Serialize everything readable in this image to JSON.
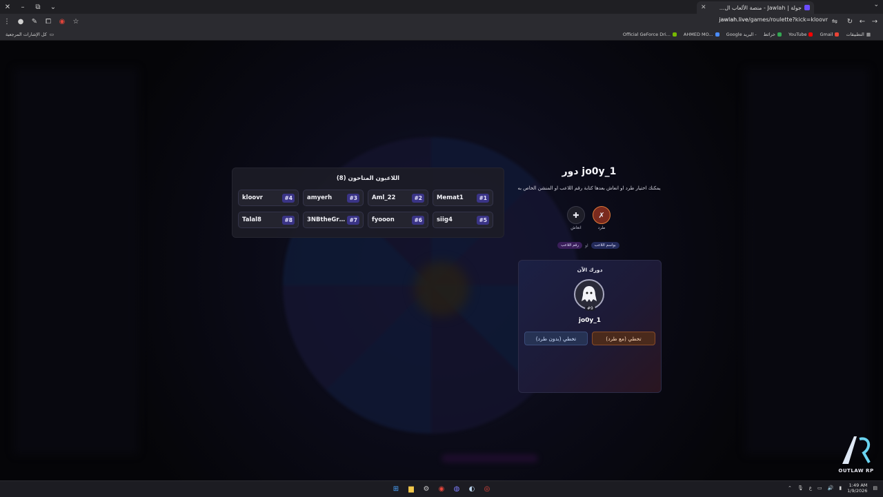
{
  "browser": {
    "tab_title": "جولة | Jawlah - منصة الألعاب ال...",
    "url_host": "jawlah.live",
    "url_path": "/games/roulette?kick=kloovr",
    "bookmarks_left": "كل الإشارات المرجعية",
    "bookmarks": [
      "Official GeForce Dri...",
      "AHMED MO...",
      "Google البريد -",
      "خرائط",
      "YouTube",
      "Gmail",
      "التطبيقات"
    ]
  },
  "players": {
    "title": "اللاعبون المتاحون (8)",
    "items": [
      {
        "name": "kloovr",
        "num": "#4"
      },
      {
        "name": "amyerh",
        "num": "#3"
      },
      {
        "name": "Aml_22",
        "num": "#2"
      },
      {
        "name": "Memat1",
        "num": "#1"
      },
      {
        "name": "Talal8",
        "num": "#8"
      },
      {
        "name": "3NBtheGrea...",
        "num": "#7"
      },
      {
        "name": "fyooon",
        "num": "#6"
      },
      {
        "name": "siig4",
        "num": "#5"
      }
    ]
  },
  "turn": {
    "title": "دور jo0y_1",
    "description": "يمكنك اختيار طرد او انعاش بعدها كتابة رقم اللاعب او المنشن الخاص به",
    "actions": [
      {
        "label": "طرد",
        "icon": "kick-icon"
      },
      {
        "label": "انعاش",
        "icon": "revive-icon"
      }
    ],
    "chip_mention": "بواسم اللاعب",
    "chip_or": "او",
    "chip_number": "رقم اللاعب",
    "card_label": "دورك الآن",
    "player_name": "jo0y_1",
    "player_num": "#9",
    "btn_skip_no_kick": "تخطي (بدون طرد)",
    "btn_skip_with_kick": "تخطي (مع طرد)"
  },
  "logo": {
    "text": "OUTLAW RP"
  },
  "taskbar": {
    "time": "1:49 AM",
    "date": "1/9/2026",
    "lang": "ع"
  },
  "colors": {
    "accent": "#3a3486",
    "orange": "#8a4c28",
    "blue": "#3b4c7a"
  }
}
